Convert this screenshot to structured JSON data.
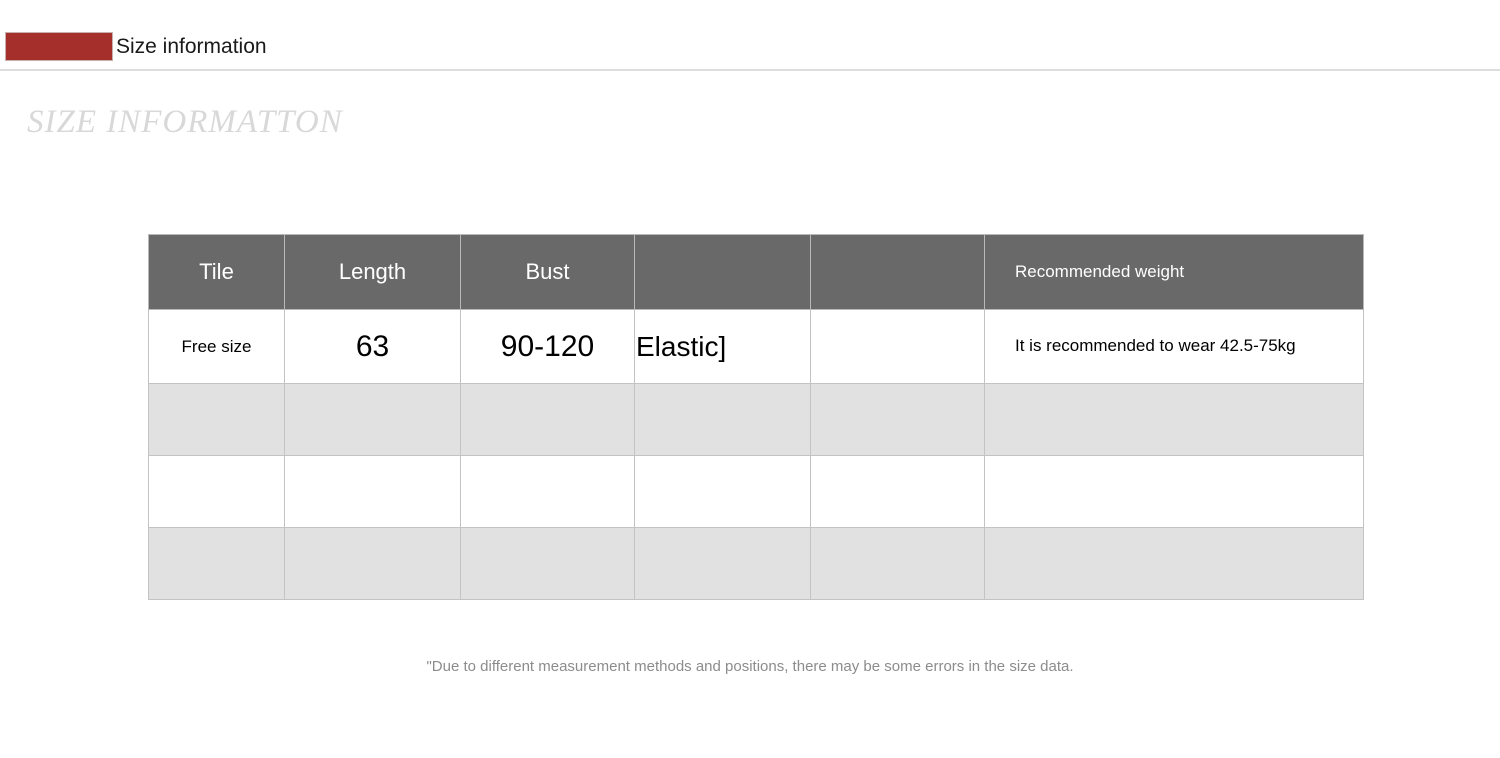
{
  "topbar": {
    "title": "Size information",
    "accent_color": "#a5302b"
  },
  "page": {
    "heading": "SIZE INFORMATTON"
  },
  "table": {
    "header_bg": "#696969",
    "stripe_color": "#e1e1e1",
    "border_color": "#c3c3c3",
    "columns": [
      {
        "key": "tile",
        "label": "Tile"
      },
      {
        "key": "length",
        "label": "Length"
      },
      {
        "key": "bust",
        "label": "Bust"
      },
      {
        "key": "col4",
        "label": ""
      },
      {
        "key": "col5",
        "label": ""
      },
      {
        "key": "rec_weight",
        "label": "Recommended weight"
      }
    ],
    "rows": [
      {
        "tile": "Free size",
        "length": "63",
        "bust": "90-120",
        "col4": "Elastic]",
        "col5": "",
        "rec_weight": "It is recommended to wear 42.5-75kg"
      }
    ],
    "blank_rows": 3
  },
  "footnote": {
    "text": "\"Due to different measurement methods and positions, there may be some errors in the size data."
  }
}
